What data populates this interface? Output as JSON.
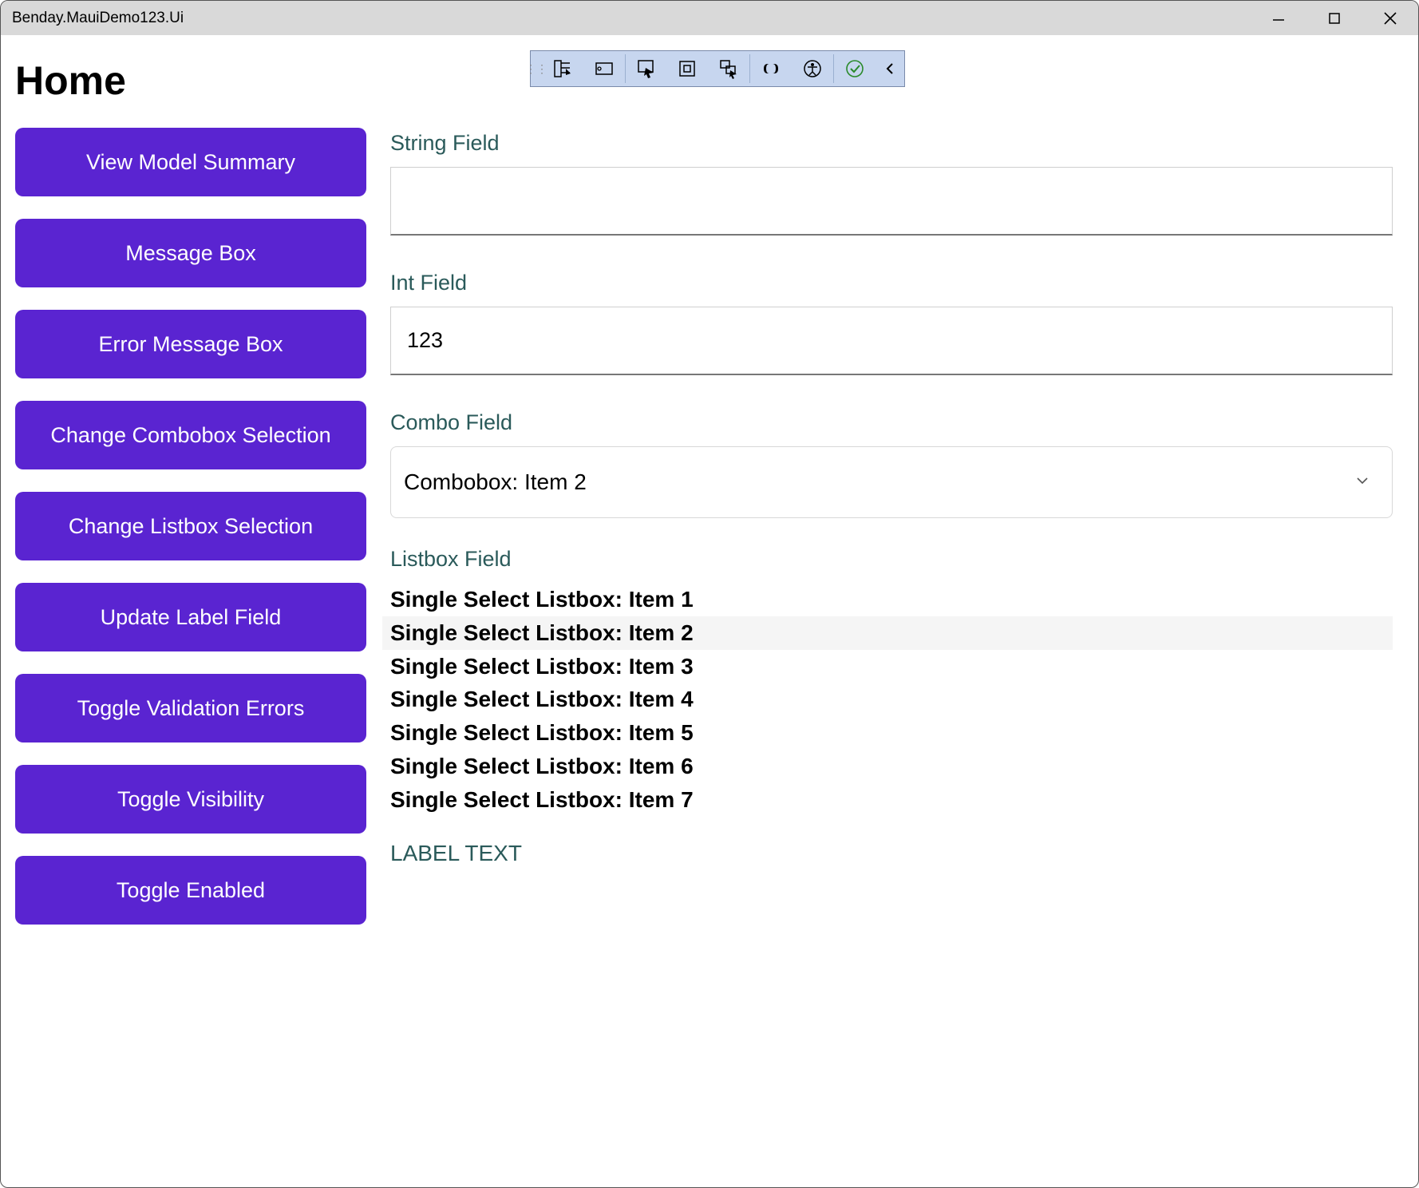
{
  "window": {
    "title": "Benday.MauiDemo123.Ui"
  },
  "page": {
    "title": "Home"
  },
  "buttons": {
    "view_model_summary": "View Model Summary",
    "message_box": "Message Box",
    "error_message_box": "Error Message Box",
    "change_combobox": "Change Combobox Selection",
    "change_listbox": "Change Listbox Selection",
    "update_label": "Update Label Field",
    "toggle_validation": "Toggle Validation Errors",
    "toggle_visibility": "Toggle Visibility",
    "toggle_enabled": "Toggle Enabled"
  },
  "fields": {
    "string": {
      "label": "String Field",
      "value": ""
    },
    "int": {
      "label": "Int Field",
      "value": "123"
    },
    "combo": {
      "label": "Combo Field",
      "value": "Combobox: Item 2"
    },
    "listbox": {
      "label": "Listbox Field",
      "items": [
        "Single Select Listbox: Item 1",
        "Single Select Listbox: Item 2",
        "Single Select Listbox: Item 3",
        "Single Select Listbox: Item 4",
        "Single Select Listbox: Item 5",
        "Single Select Listbox: Item 6",
        "Single Select Listbox: Item 7"
      ],
      "selected_index": 1
    },
    "label_text": "LABEL TEXT"
  }
}
